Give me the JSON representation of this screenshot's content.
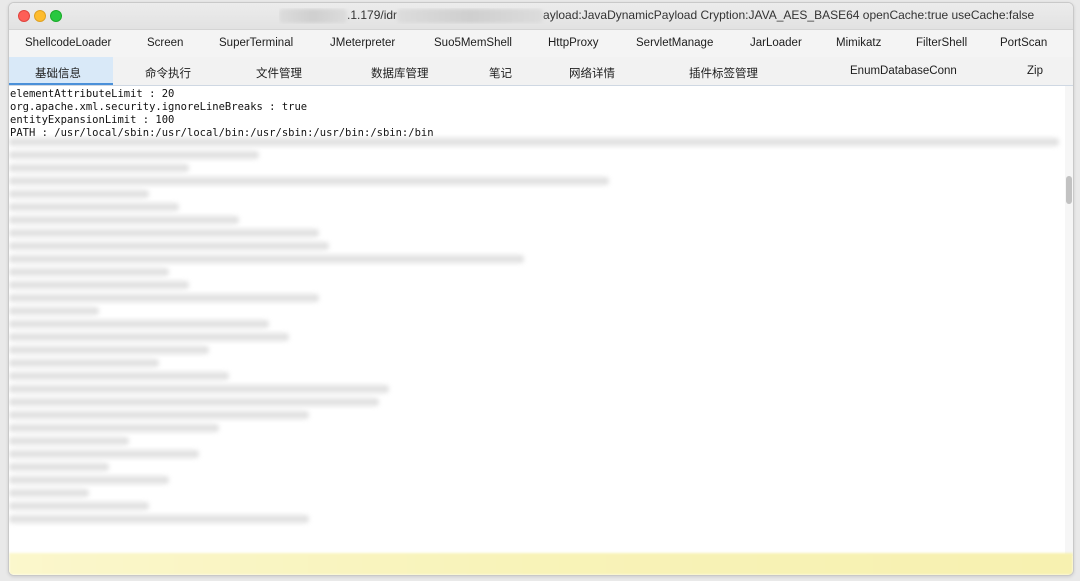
{
  "window": {
    "title_visible": ".1.179/idr",
    "title_tail": "ayload:JavaDynamicPayload Cryption:JAVA_AES_BASE64 openCache:true useCache:false"
  },
  "plugin_tabs": [
    "ShellcodeLoader",
    "Screen",
    "SuperTerminal",
    "JMeterpreter",
    "Suo5MemShell",
    "HttpProxy",
    "ServletManage",
    "JarLoader",
    "Mimikatz",
    "FilterShell",
    "PortScan"
  ],
  "main_tabs": [
    "基础信息",
    "命令执行",
    "文件管理",
    "数据库管理",
    "笔记",
    "网络详情",
    "插件标签管理",
    "EnumDatabaseConn",
    "Zip"
  ],
  "active_tab": "基础信息",
  "content_lines": [
    "elementAttributeLimit : 20",
    "org.apache.xml.security.ignoreLineBreaks : true",
    "entityExpansionLimit : 100",
    "PATH : /usr/local/sbin:/usr/local/bin:/usr/sbin:/usr/bin:/sbin:/bin"
  ],
  "colors": {
    "active_tab_bg": "#d9e9f8",
    "close": "#fe5f57",
    "minimize": "#febc2e",
    "maximize": "#28c840"
  }
}
